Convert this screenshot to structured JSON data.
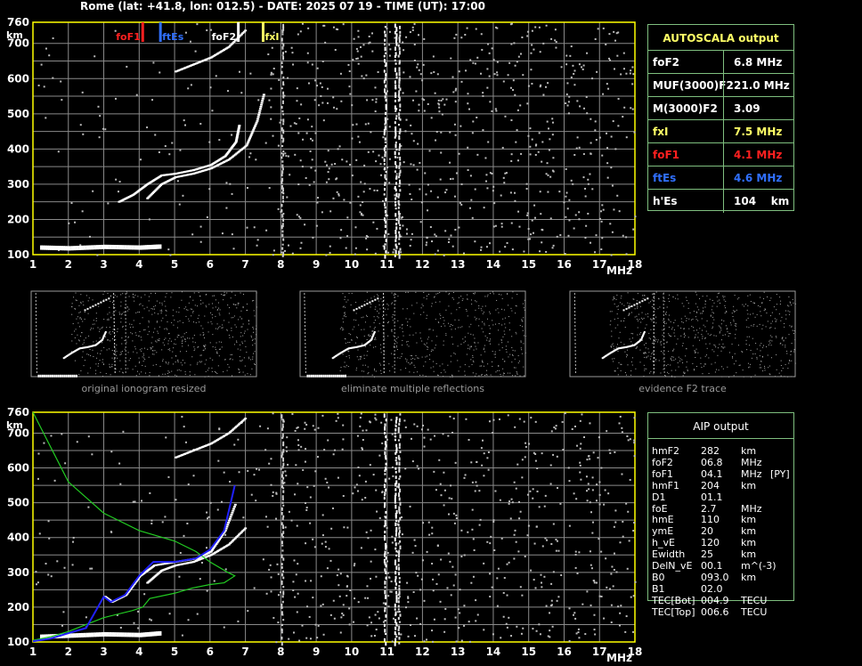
{
  "header": {
    "title": "Rome (lat: +41.8, lon: 012.5) - DATE: 2025 07 19 - TIME (UT): 17:00"
  },
  "colors": {
    "background": "#000000",
    "grid": "#8a8a8a",
    "axis": "#ffff00",
    "green": "#7fbf7f",
    "red": "#ff2020",
    "blue": "#3070ff",
    "yellow": "#ffff66",
    "fit_green": "#22cc22",
    "fit_blue": "#2020ff"
  },
  "autoscala": {
    "title": "AUTOSCALA output",
    "rows": [
      {
        "label": "foF2",
        "value": "6.8 MHz",
        "color": "#ffffff"
      },
      {
        "label": "MUF(3000)F2",
        "value": "21.0 MHz",
        "color": "#ffffff"
      },
      {
        "label": "M(3000)F2",
        "value": "3.09",
        "color": "#ffffff"
      },
      {
        "label": "fxI",
        "value": "7.5 MHz",
        "color": "#ffff66"
      },
      {
        "label": "foF1",
        "value": "4.1 MHz",
        "color": "#ff2020"
      },
      {
        "label": "ftEs",
        "value": "4.6 MHz",
        "color": "#3070ff"
      },
      {
        "label": "h'Es",
        "value": "104    km",
        "color": "#ffffff"
      }
    ]
  },
  "thumbnails": [
    {
      "caption": "original ionogram resized"
    },
    {
      "caption": "eliminate multiple reflections"
    },
    {
      "caption": "evidence F2 trace"
    }
  ],
  "aip": {
    "title": "AIP output",
    "rows": [
      [
        "hmF2",
        "282",
        "km",
        ""
      ],
      [
        "foF2",
        "06.8",
        "MHz",
        ""
      ],
      [
        "foF1",
        "04.1",
        "MHz",
        "[PY]"
      ],
      [
        "hmF1",
        "204",
        "km",
        ""
      ],
      [
        "D1",
        "01.1",
        "",
        ""
      ],
      [
        "foE",
        "2.7",
        "MHz",
        ""
      ],
      [
        "hmE",
        "110",
        "km",
        ""
      ],
      [
        "ymE",
        "20",
        "km",
        ""
      ],
      [
        "h_vE",
        "120",
        "km",
        ""
      ],
      [
        "Ewidth",
        "25",
        "km",
        ""
      ],
      [
        "DelN_vE",
        "00.1",
        "m^(-3)",
        ""
      ],
      [
        "B0",
        "093.0",
        "km",
        ""
      ],
      [
        "B1",
        "02.0",
        "",
        ""
      ],
      [
        "TEC[Bot]",
        "004.9",
        "TECU",
        ""
      ],
      [
        "TEC[Top]",
        "006.6",
        "TECU",
        ""
      ]
    ]
  },
  "chart_data": [
    {
      "type": "scatter",
      "title": "",
      "xlabel": "MHz",
      "ylabel": "km",
      "xlim": [
        1,
        18
      ],
      "ylim": [
        100,
        760
      ],
      "x_ticks": [
        "1",
        "2",
        "3",
        "4",
        "5",
        "6",
        "7",
        "8",
        "9",
        "10",
        "11",
        "12",
        "13",
        "14",
        "15",
        "16",
        "17",
        "18"
      ],
      "y_ticks": [
        "100",
        "200",
        "300",
        "400",
        "500",
        "600",
        "700",
        "760"
      ],
      "markers": [
        {
          "name": "foF1",
          "x": 4.1,
          "color": "#ff2020"
        },
        {
          "name": "ftEs",
          "x": 4.6,
          "color": "#3070ff"
        },
        {
          "name": "foF2",
          "x": 6.8,
          "color": "#ffffff"
        },
        {
          "name": "fxI",
          "x": 7.5,
          "color": "#ffff66"
        }
      ],
      "series": [
        {
          "x": [
            1.2,
            2,
            3,
            4,
            4.6
          ],
          "y": [
            120,
            118,
            122,
            120,
            123
          ]
        },
        {
          "x": [
            3.4,
            3.8,
            4.2,
            4.6,
            5,
            5.5,
            6,
            6.4,
            6.7,
            6.8
          ],
          "y": [
            250,
            270,
            300,
            325,
            330,
            340,
            355,
            380,
            420,
            470
          ]
        },
        {
          "x": [
            4.2,
            4.6,
            5,
            5.5,
            6,
            6.5,
            7,
            7.3,
            7.5
          ],
          "y": [
            260,
            300,
            320,
            330,
            345,
            370,
            410,
            480,
            560
          ]
        },
        {
          "x": [
            5,
            5.5,
            6,
            6.5,
            7
          ],
          "y": [
            620,
            640,
            660,
            690,
            740
          ]
        }
      ]
    },
    {
      "type": "scatter",
      "title": "",
      "xlabel": "MHz",
      "ylabel": "km",
      "xlim": [
        1,
        18
      ],
      "ylim": [
        100,
        760
      ],
      "x_ticks": [
        "1",
        "2",
        "3",
        "4",
        "5",
        "6",
        "7",
        "8",
        "9",
        "10",
        "11",
        "12",
        "13",
        "14",
        "15",
        "16",
        "17",
        "18"
      ],
      "y_ticks": [
        "100",
        "200",
        "300",
        "400",
        "500",
        "600",
        "700",
        "760"
      ],
      "series": [
        {
          "x": [
            1.2,
            2,
            3,
            4,
            4.6
          ],
          "y": [
            115,
            118,
            122,
            120,
            125
          ]
        },
        {
          "x": [
            3,
            3.2,
            3.6,
            4,
            4.4,
            5,
            5.6,
            6,
            6.4,
            6.7
          ],
          "y": [
            230,
            215,
            235,
            290,
            320,
            330,
            340,
            360,
            420,
            500
          ]
        },
        {
          "x": [
            4.2,
            4.6,
            5,
            5.5,
            6,
            6.5,
            7
          ],
          "y": [
            270,
            305,
            320,
            330,
            350,
            380,
            430
          ]
        },
        {
          "x": [
            5,
            5.5,
            6,
            6.5,
            7
          ],
          "y": [
            630,
            650,
            670,
            700,
            745
          ]
        }
      ],
      "fit_green": {
        "x": [
          1,
          1.5,
          2,
          3,
          4,
          5,
          5.6,
          6,
          6.5,
          6.7,
          6.4,
          6,
          5.5,
          5,
          4.3,
          4.1,
          3.8,
          3,
          2.5,
          2,
          1.5,
          1
        ],
        "y": [
          760,
          660,
          560,
          470,
          420,
          390,
          360,
          330,
          300,
          290,
          270,
          265,
          255,
          240,
          225,
          200,
          190,
          170,
          150,
          130,
          115,
          105
        ]
      },
      "fit_blue": {
        "x": [
          1,
          1.5,
          2,
          2.5,
          3,
          3.2,
          3.6,
          4,
          4.4,
          5,
          5.6,
          6,
          6.4,
          6.7
        ],
        "y": [
          102,
          110,
          125,
          140,
          230,
          215,
          235,
          290,
          330,
          330,
          340,
          365,
          420,
          550
        ]
      }
    }
  ]
}
